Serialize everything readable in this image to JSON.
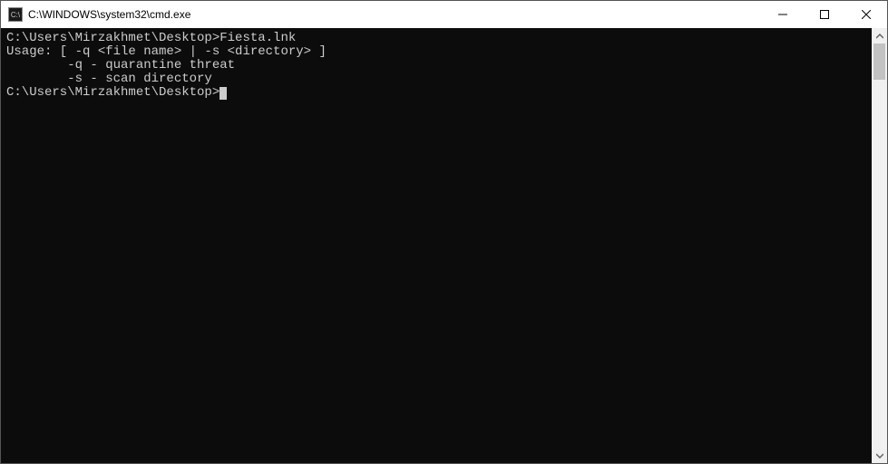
{
  "window": {
    "title": "C:\\WINDOWS\\system32\\cmd.exe",
    "icon_label": "C:\\"
  },
  "terminal": {
    "lines": [
      "C:\\Users\\Mirzakhmet\\Desktop>Fiesta.lnk",
      "Usage: [ -q <file name> | -s <directory> ]",
      "        -q - quarantine threat",
      "        -s - scan directory",
      "",
      "C:\\Users\\Mirzakhmet\\Desktop>"
    ],
    "prompt": "C:\\Users\\Mirzakhmet\\Desktop>",
    "last_command": "Fiesta.lnk",
    "usage_header": "Usage: [ -q <file name> | -s <directory> ]",
    "options": [
      {
        "flag": "-q",
        "desc": "quarantine threat"
      },
      {
        "flag": "-s",
        "desc": "scan directory"
      }
    ]
  }
}
